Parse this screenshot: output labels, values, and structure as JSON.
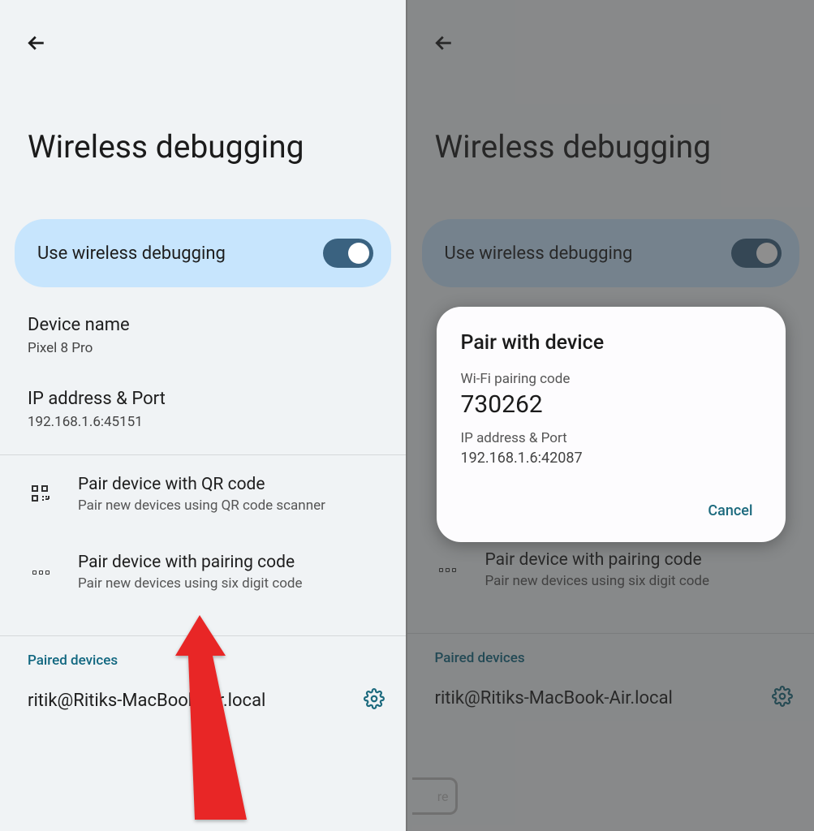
{
  "left": {
    "title": "Wireless debugging",
    "toggle_label": "Use wireless debugging",
    "device_name_label": "Device name",
    "device_name_value": "Pixel 8 Pro",
    "ip_port_label": "IP address & Port",
    "ip_port_value": "192.168.1.6:45151",
    "pair_qr_title": "Pair device with QR code",
    "pair_qr_sub": "Pair new devices using QR code scanner",
    "pair_code_title": "Pair device with pairing code",
    "pair_code_sub": "Pair new devices using six digit code",
    "paired_devices_header": "Paired devices",
    "paired_device_1": "ritik@Ritiks-MacBook-Air.local"
  },
  "right": {
    "title": "Wireless debugging",
    "toggle_label": "Use wireless debugging",
    "pair_code_title": "Pair device with pairing code",
    "pair_code_sub": "Pair new devices using six digit code",
    "paired_devices_header": "Paired devices",
    "paired_device_1": "ritik@Ritiks-MacBook-Air.local",
    "partial_btn": "re"
  },
  "dialog": {
    "title": "Pair with device",
    "code_label": "Wi-Fi pairing code",
    "code_value": "730262",
    "ip_label": "IP address & Port",
    "ip_value": "192.168.1.6:42087",
    "cancel": "Cancel"
  }
}
